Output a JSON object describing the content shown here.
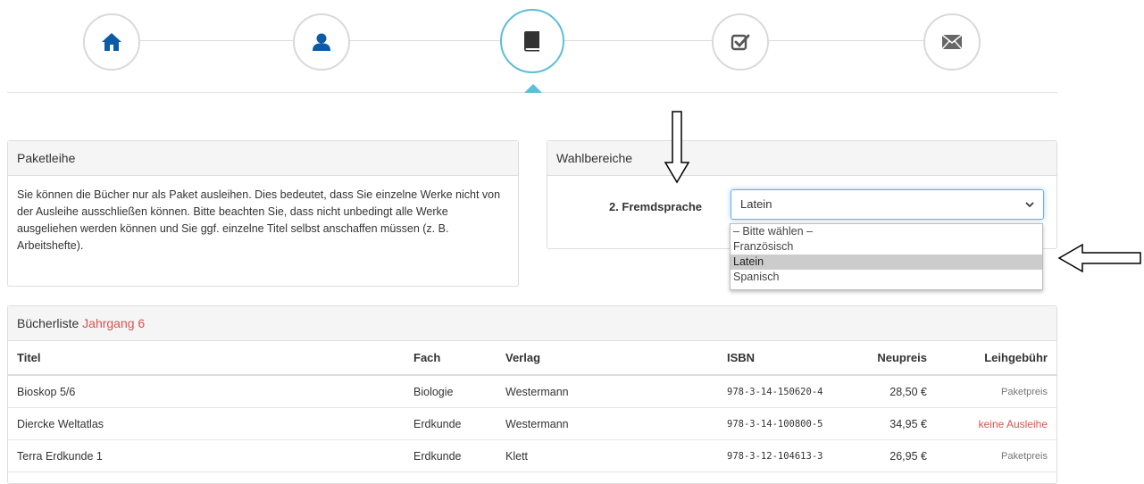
{
  "stepper": {
    "steps": [
      {
        "icon": "home-icon",
        "active": false
      },
      {
        "icon": "user-icon",
        "active": false
      },
      {
        "icon": "book-icon",
        "active": true
      },
      {
        "icon": "check-square-icon",
        "active": false
      },
      {
        "icon": "envelope-icon",
        "active": false
      }
    ],
    "accent_color": "#5bbfd8",
    "icon_color": "#0d5aa7"
  },
  "paketleihe": {
    "title": "Paketleihe",
    "text": "Sie können die Bücher nur als Paket ausleihen. Dies bedeutet, dass Sie einzelne Werke nicht von der Ausleihe ausschließen können. Bitte beachten Sie, dass nicht unbedingt alle Werke ausgeliehen werden können und Sie ggf. einzelne Titel selbst anschaffen müssen (z. B. Arbeitshefte)."
  },
  "wahlbereiche": {
    "title": "Wahlbereiche",
    "label": "2. Fremdsprache",
    "selected": "Latein",
    "options": [
      "– Bitte wählen –",
      "Französisch",
      "Latein",
      "Spanisch"
    ],
    "selected_index": 2
  },
  "buecherliste": {
    "title_prefix": "Bücherliste",
    "title_highlight": "Jahrgang 6",
    "columns": [
      "Titel",
      "Fach",
      "Verlag",
      "ISBN",
      "Neupreis",
      "Leihgebühr"
    ],
    "rows": [
      {
        "titel": "Bioskop 5/6",
        "fach": "Biologie",
        "verlag": "Westermann",
        "isbn": "978-3-14-150620-4",
        "neupreis": "28,50 €",
        "leihgebuehr": "Paketpreis"
      },
      {
        "titel": "Diercke Weltatlas",
        "fach": "Erdkunde",
        "verlag": "Westermann",
        "isbn": "978-3-14-100800-5",
        "neupreis": "34,95 €",
        "leihgebuehr": "keine Ausleihe"
      },
      {
        "titel": "Terra Erdkunde 1",
        "fach": "Erdkunde",
        "verlag": "Klett",
        "isbn": "978-3-12-104613-3",
        "neupreis": "26,95 €",
        "leihgebuehr": "Paketpreis"
      }
    ],
    "highlight_color": "#d9534f"
  }
}
